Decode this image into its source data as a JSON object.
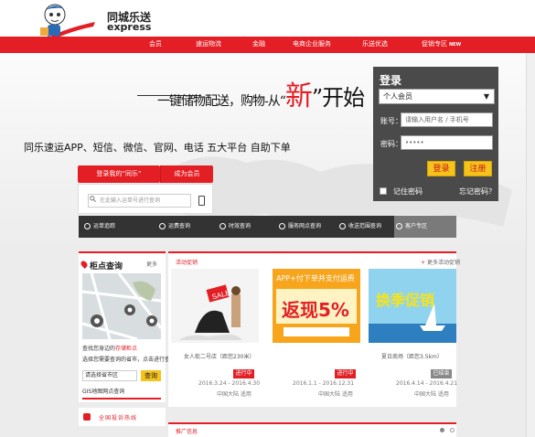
{
  "header": {
    "logo_title": "同城乐送",
    "logo_sub": "express"
  },
  "nav": {
    "items": [
      "会员",
      "速运物流",
      "金融",
      "电商企业服务",
      "乐送优选",
      "促销专区"
    ],
    "new_badge": "NEW"
  },
  "banner": {
    "slogan_prefix": "一键储物配送，购物-从“",
    "slogan_highlight": "新",
    "slogan_suffix": "”开始",
    "tagline": "同乐速运APP、短信、微信、官网、电话  五大平台  自助下单"
  },
  "quick_actions": {
    "login_alt_label": "登录我的“同乐”",
    "member_label": "成为会员",
    "track_placeholder": "在此输入运单号进行查询"
  },
  "login": {
    "title": "登录",
    "role_value": "个人会员",
    "account_label": "账号：",
    "account_placeholder": "请输入用户名 / 手机号",
    "password_label": "密码：",
    "password_value": "•••••",
    "login_btn": "登录",
    "register_btn": "注册",
    "remember_label": "记住密码",
    "forgot_label": "忘记密码？"
  },
  "services": [
    "运单追踪",
    "运费查询",
    "时效查询",
    "服务网点查询",
    "收送范围查询",
    "客户专区"
  ],
  "lockers": {
    "title": "柜点查询",
    "more": "更多",
    "line1_prefix": "查找您身边的",
    "line1_highlight": "存储柜点",
    "line2": "选择您需要查询的省市，点击进行查询",
    "city_value": "请选择省市区",
    "query_btn": "查询",
    "gis_text": "GIS地图网点查询"
  },
  "hotline": {
    "text": "全国投诉热线"
  },
  "promo": {
    "title": "活动促销",
    "more": "更多活动促销",
    "cards": [
      {
        "name": "女人街二号店（距您230米）",
        "date": "2016.3.24 - 2016.4.30",
        "area": "中国大陆 适用",
        "status": "进行中",
        "banner_text": ""
      },
      {
        "name": "",
        "date": "2016.1.1 - 2016.12.31",
        "area": "中国大陆 适用",
        "status": "进行中",
        "banner_text": "APP+付下单并支付运费"
      },
      {
        "name": "夏日商场（距您3.5km）",
        "date": "2016.4.14 - 2016.4.21",
        "area": "中国大陆 适用",
        "status": "已结束",
        "banner_text": ""
      }
    ]
  },
  "recommend": {
    "title": "推广信息"
  },
  "colors": {
    "brand_red": "#e31e24",
    "accent_yellow": "#f6c21c",
    "panel_dark": "#4a4a4a"
  }
}
